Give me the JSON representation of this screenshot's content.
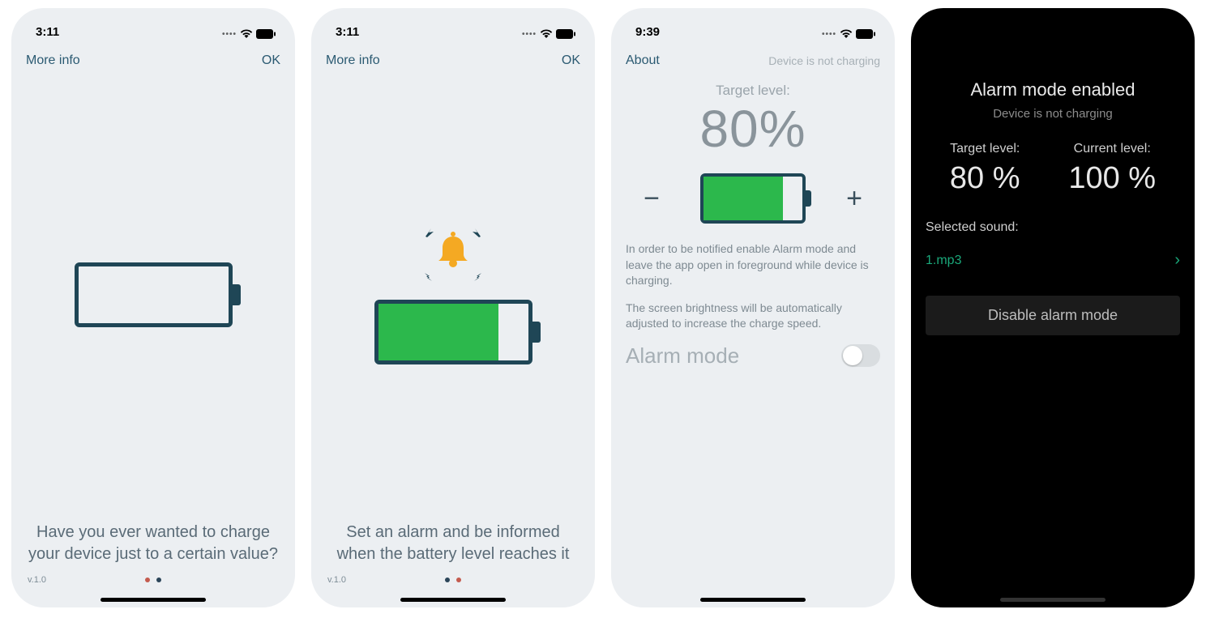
{
  "screen1": {
    "time": "3:11",
    "nav_left": "More info",
    "nav_right": "OK",
    "caption": "Have you ever wanted to charge your device just to a certain value?",
    "version": "v.1.0",
    "battery_fill_pct": 0,
    "active_page_index": 0
  },
  "screen2": {
    "time": "3:11",
    "nav_left": "More info",
    "nav_right": "OK",
    "caption": "Set an alarm and be informed when the battery level reaches it",
    "version": "v.1.0",
    "battery_fill_pct": 80,
    "active_page_index": 1
  },
  "screen3": {
    "time": "9:39",
    "nav_left": "About",
    "nav_right": "Device is not charging",
    "target_label": "Target level:",
    "target_value": "80%",
    "battery_fill_pct": 80,
    "info1": "In order to be notified enable Alarm mode and leave the app open in foreground while device is charging.",
    "info2": "The screen brightness will be automatically adjusted to increase the charge speed.",
    "mode_label": "Alarm mode",
    "mode_on": false
  },
  "screen4": {
    "title": "Alarm mode enabled",
    "subtitle": "Device is not charging",
    "target_label": "Target level:",
    "target_value": "80 %",
    "current_label": "Current level:",
    "current_value": "100 %",
    "sound_label": "Selected sound:",
    "sound_value": "1.mp3",
    "button": "Disable alarm mode"
  }
}
